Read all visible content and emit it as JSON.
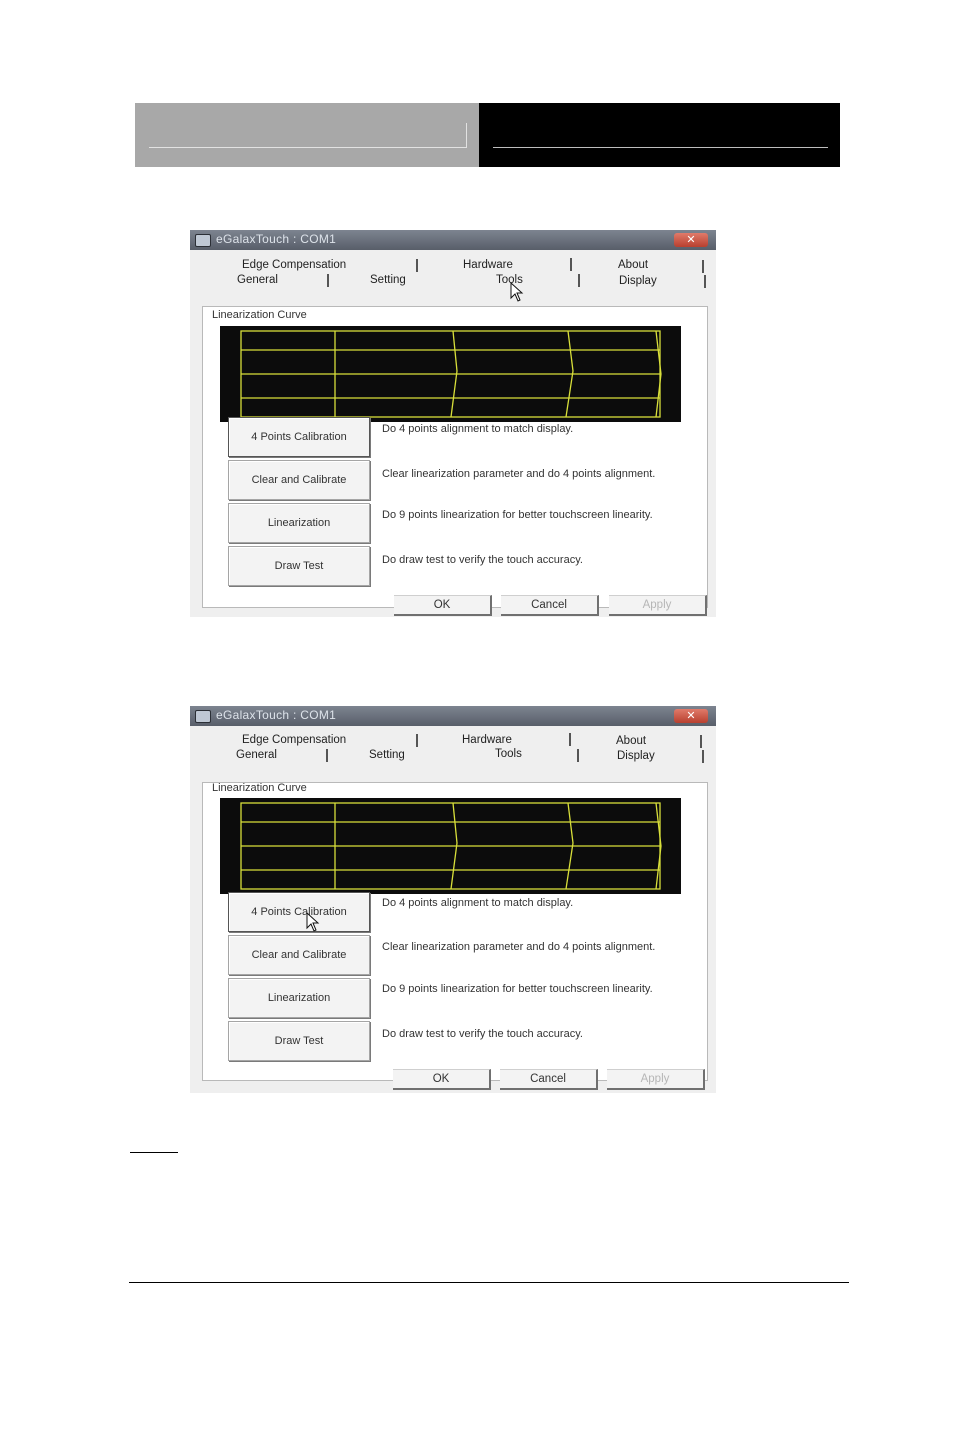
{
  "screenshots": [
    {
      "window_title": "eGalaxTouch : COM1",
      "close_label": "✕",
      "tabs_top": [
        "Edge Compensation",
        "Hardware",
        "About"
      ],
      "tabs_bottom": [
        "General",
        "Setting",
        "Tools",
        "Display"
      ],
      "active_tab": "Tools",
      "group_label": "Linearization Curve",
      "actions": [
        {
          "label": "4 Points Calibration",
          "description": "Do 4 points alignment to match display."
        },
        {
          "label": "Clear and Calibrate",
          "description": "Clear linearization parameter and do 4 points alignment."
        },
        {
          "label": "Linearization",
          "description": "Do 9 points linearization for better touchscreen linearity."
        },
        {
          "label": "Draw Test",
          "description": "Do draw test to verify the touch accuracy."
        }
      ],
      "footer_buttons": {
        "ok": "OK",
        "cancel": "Cancel",
        "apply": "Apply"
      },
      "pointer_on": "Tools tab"
    },
    {
      "window_title": "eGalaxTouch : COM1",
      "close_label": "✕",
      "tabs_top": [
        "Edge Compensation",
        "Hardware",
        "About"
      ],
      "tabs_bottom": [
        "General",
        "Setting",
        "Tools",
        "Display"
      ],
      "active_tab": "Tools",
      "group_label": "Linearization Curve",
      "actions": [
        {
          "label": "4 Points Calibration",
          "description": "Do 4 points alignment to match display."
        },
        {
          "label": "Clear and Calibrate",
          "description": "Clear linearization parameter and do 4 points alignment."
        },
        {
          "label": "Linearization",
          "description": "Do 9 points linearization for better touchscreen linearity."
        },
        {
          "label": "Draw Test",
          "description": "Do draw test to verify the touch accuracy."
        }
      ],
      "footer_buttons": {
        "ok": "OK",
        "cancel": "Cancel",
        "apply": "Apply"
      },
      "pointer_on": "4 Points Calibration button"
    }
  ],
  "colors": {
    "header_left": "#a8a8a8",
    "header_right": "#000000",
    "curve_background": "#0c0c0c",
    "curve_line": "#d8df3a"
  }
}
